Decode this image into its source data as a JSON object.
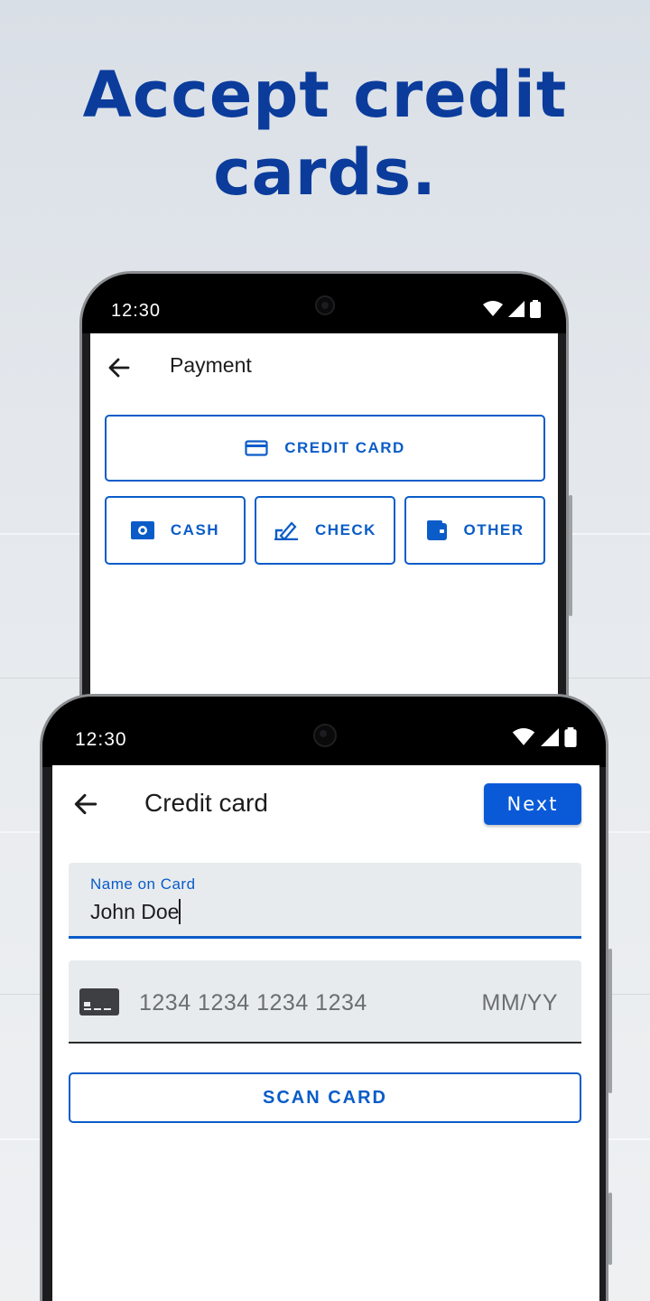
{
  "headline": {
    "line1": "Accept credit",
    "line2": "cards."
  },
  "payment_phone": {
    "status_time": "12:30",
    "header": {
      "title": "Payment"
    },
    "methods": {
      "credit_card": "CREDIT CARD",
      "cash": "CASH",
      "check": "CHECK",
      "other": "OTHER"
    }
  },
  "credit_phone": {
    "status_time": "12:30",
    "header": {
      "title": "Credit card",
      "next_label": "Next"
    },
    "name_field": {
      "label": "Name on Card",
      "value": "John Doe"
    },
    "card_field": {
      "number_placeholder": "1234 1234 1234 1234",
      "expiry_placeholder": "MM/YY"
    },
    "scan_label": "SCAN CARD"
  },
  "colors": {
    "brand_blue": "#0a5cc8",
    "headline_blue": "#0b3c9c",
    "next_button": "#0a5ad8"
  }
}
